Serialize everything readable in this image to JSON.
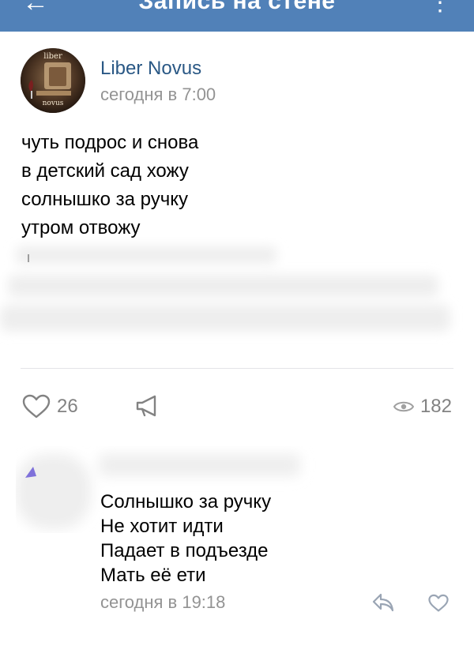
{
  "header": {
    "title": "Запись на стене",
    "back_icon": "arrow-left-icon",
    "more_icon": "more-vertical-icon",
    "bg": "#5181b8"
  },
  "post": {
    "author": "Liber Novus",
    "avatar_text_top": "liber",
    "avatar_text_bottom": "novus",
    "time": "сегодня в 7:00",
    "lines": [
      "чуть подрос и снова",
      "в детский сад хожу",
      "солнышко за ручку",
      "утром отвожу"
    ],
    "likes": "26",
    "views": "182"
  },
  "comment": {
    "lines": [
      "Солнышко за ручку",
      "Не хотит идти",
      "Падает в подъезде",
      "Мать её ети"
    ],
    "time": "сегодня в 19:18"
  },
  "colors": {
    "link": "#2a5885",
    "muted": "#939393",
    "icon": "#828282"
  }
}
